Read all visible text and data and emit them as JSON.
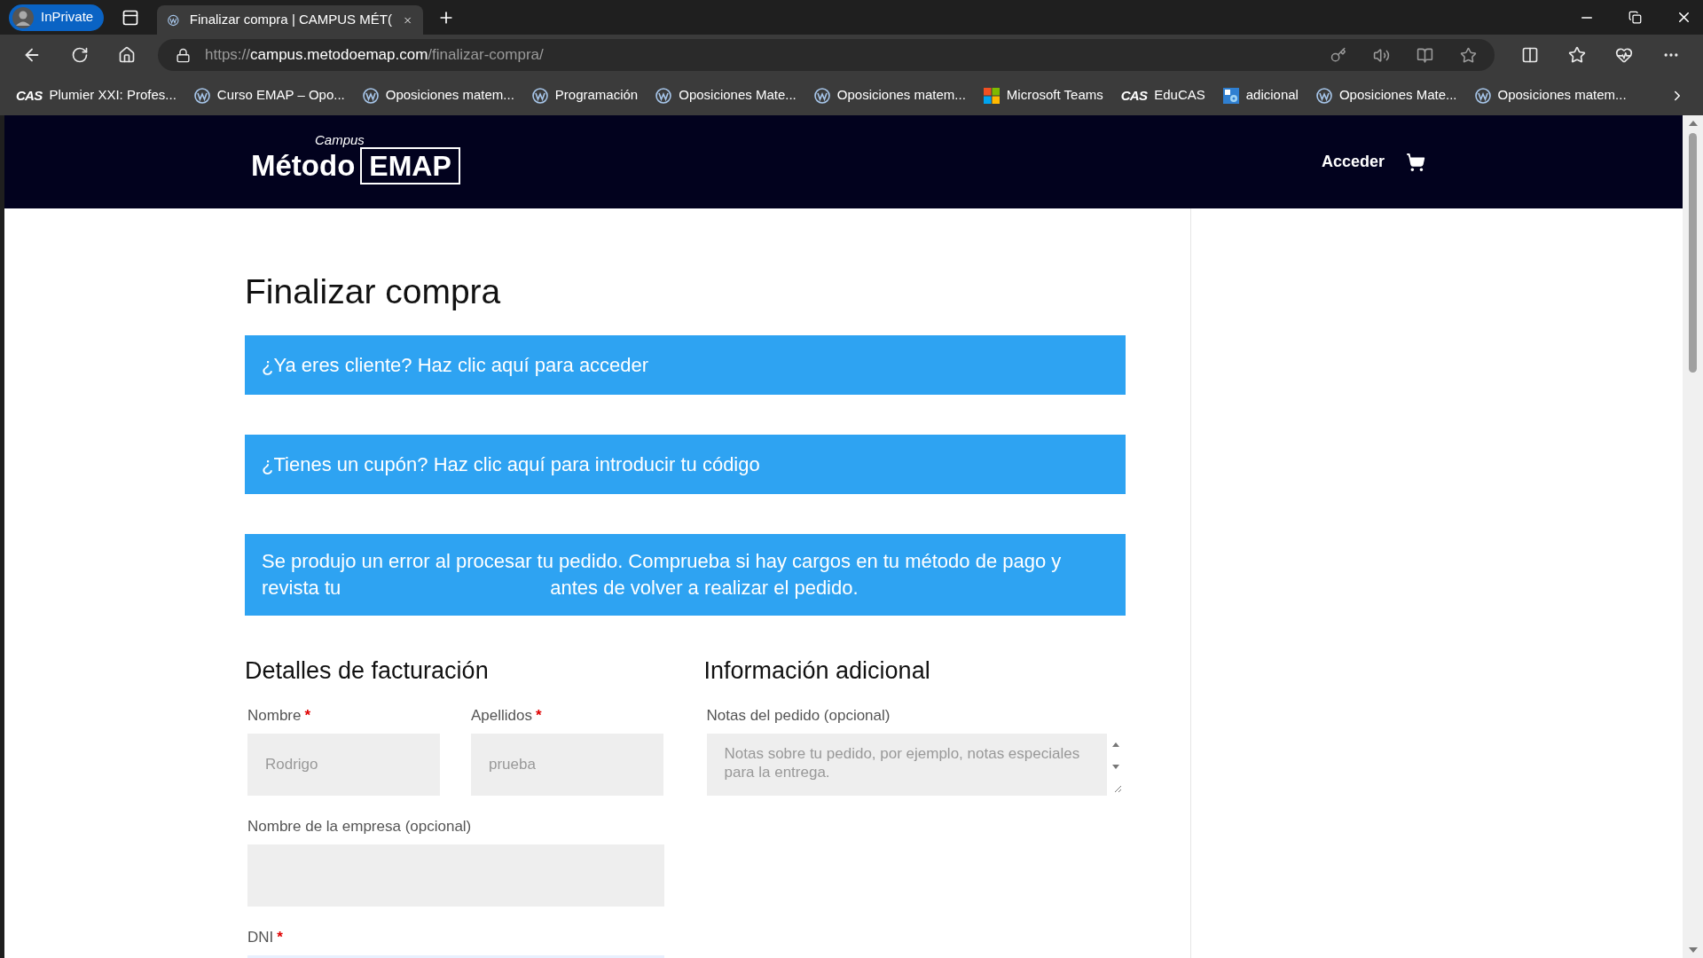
{
  "browser": {
    "profile": "InPrivate",
    "tab_title": "Finalizar compra | CAMPUS MÉT(",
    "url_scheme": "https://",
    "url_host": "campus.metodoemap.com",
    "url_path": "/finalizar-compra/",
    "bookmarks": [
      {
        "kind": "cas",
        "icon_text": "CAS",
        "label": "Plumier XXI: Profes..."
      },
      {
        "kind": "wp",
        "label": "Curso EMAP – Opo..."
      },
      {
        "kind": "wp",
        "label": "Oposiciones matem..."
      },
      {
        "kind": "wp",
        "label": "Programación"
      },
      {
        "kind": "wp",
        "label": "Oposiciones Mate..."
      },
      {
        "kind": "wp",
        "label": "Oposiciones matem..."
      },
      {
        "kind": "ms",
        "label": "Microsoft Teams"
      },
      {
        "kind": "cas",
        "icon_text": "CAS",
        "label": "EduCAS"
      },
      {
        "kind": "gear",
        "label": "adicional"
      },
      {
        "kind": "wp",
        "label": "Oposiciones Mate..."
      },
      {
        "kind": "wp",
        "label": "Oposiciones matem..."
      }
    ]
  },
  "site": {
    "logo": {
      "script": "Campus",
      "name": "Método",
      "boxed": "EMAP"
    },
    "nav": [
      "Acceder"
    ]
  },
  "page": {
    "title": "Finalizar compra",
    "notices": [
      {
        "kind": "info",
        "text": "¿Ya eres cliente? Haz clic aquí para acceder"
      },
      {
        "kind": "info",
        "text": "¿Tienes un cupón? Haz clic aquí para introducir tu código"
      },
      {
        "kind": "error",
        "parts": [
          "Se produjo un error al procesar tu pedido. Comprueba si hay cargos en tu método de pago y revista tu",
          "antes de volver a realizar el pedido."
        ]
      }
    ],
    "billing": {
      "heading": "Detalles de facturación",
      "fields": [
        {
          "kind": "half",
          "label": "Nombre",
          "required_mark": "*",
          "value": "Rodrigo",
          "focused": false
        },
        {
          "kind": "half",
          "label": "Apellidos",
          "required_mark": "*",
          "value": "prueba",
          "focused": false
        },
        {
          "kind": "full",
          "label": "Nombre de la empresa (opcional)",
          "focused": false
        },
        {
          "kind": "full",
          "label": "DNI",
          "required_mark": "*",
          "focused": true
        }
      ]
    },
    "additional": {
      "heading": "Información adicional",
      "label": "Notas del pedido (opcional)",
      "placeholder": "Notas sobre tu pedido, por ejemplo, notas especiales para la entrega."
    }
  }
}
